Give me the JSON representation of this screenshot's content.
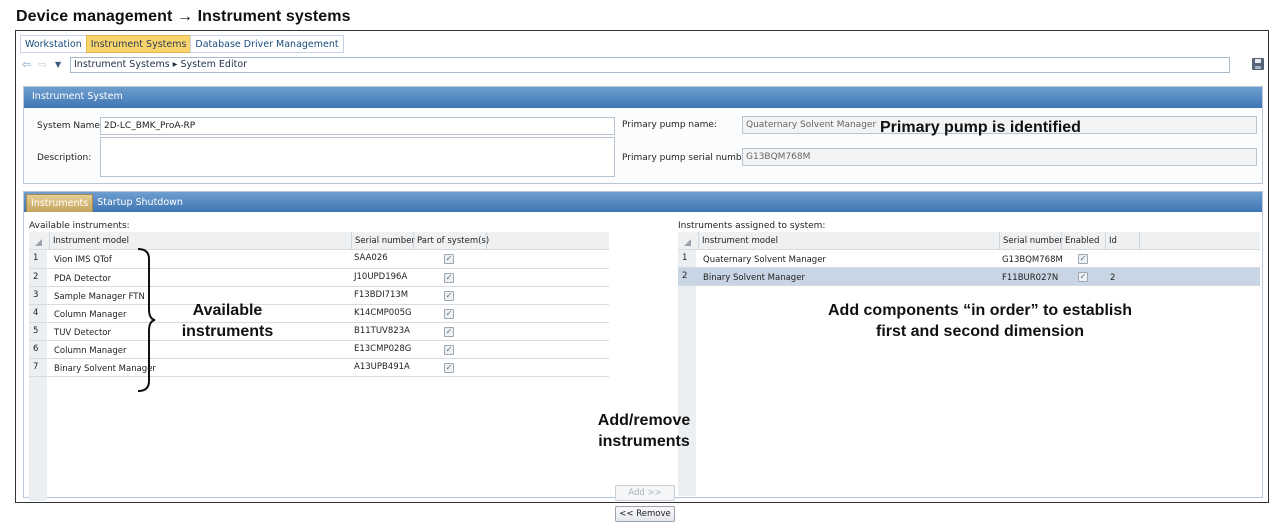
{
  "heading": "Device management → Instrument systems",
  "top_tabs": [
    {
      "label": "Workstation",
      "active": false
    },
    {
      "label": "Instrument Systems",
      "active": true
    },
    {
      "label": "Database Driver Management",
      "active": false
    }
  ],
  "nav": {
    "back_icon": "back-arrow-icon",
    "forward_icon": "forward-arrow-icon",
    "dropdown_icon": "chevron-down-icon",
    "breadcrumb": "Instrument Systems ▸ System Editor",
    "save_icon": "save-icon"
  },
  "instrument_system": {
    "header": "Instrument System",
    "system_name_label": "System Name:",
    "system_name_value": "2D-LC_BMK_ProA-RP",
    "description_label": "Description:",
    "description_value": "",
    "primary_pump_name_label": "Primary pump name:",
    "primary_pump_name_value": "Quaternary Solvent Manager",
    "primary_pump_serial_label": "Primary pump serial number:",
    "primary_pump_serial_value": "G13BQM768M"
  },
  "section_tabs": [
    {
      "label": "Instruments",
      "active": true
    },
    {
      "label": "Startup Shutdown",
      "active": false
    }
  ],
  "available": {
    "caption": "Available instruments:",
    "columns": [
      "Instrument model",
      "Serial number",
      "Part of system(s)"
    ],
    "rows": [
      {
        "n": "1",
        "model": "Vion IMS QTof",
        "serial": "SAA026",
        "part": true
      },
      {
        "n": "2",
        "model": "PDA Detector",
        "serial": "J10UPD196A",
        "part": true
      },
      {
        "n": "3",
        "model": "Sample Manager FTN",
        "serial": "F13BDI713M",
        "part": true
      },
      {
        "n": "4",
        "model": "Column Manager",
        "serial": "K14CMP005G",
        "part": true
      },
      {
        "n": "5",
        "model": "TUV Detector",
        "serial": "B11TUV823A",
        "part": true
      },
      {
        "n": "6",
        "model": "Column Manager",
        "serial": "E13CMP028G",
        "part": true
      },
      {
        "n": "7",
        "model": "Binary Solvent Manager",
        "serial": "A13UPB491A",
        "part": true
      }
    ]
  },
  "assigned": {
    "caption": "Instruments assigned to system:",
    "columns": [
      "Instrument model",
      "Serial number",
      "Enabled",
      "Id"
    ],
    "rows": [
      {
        "n": "1",
        "model": "Quaternary Solvent Manager",
        "serial": "G13BQM768M",
        "enabled": true,
        "id": ""
      },
      {
        "n": "2",
        "model": "Binary Solvent Manager",
        "serial": "F11BUR027N",
        "enabled": true,
        "id": "2"
      }
    ]
  },
  "buttons": {
    "add": "Add >>",
    "remove": "<< Remove"
  },
  "annotations": {
    "primary_pump": "Primary pump is identified",
    "available_line1": "Available",
    "available_line2": "instruments",
    "add_remove_line1": "Add/remove",
    "add_remove_line2": "instruments",
    "order_line1": "Add components “in order” to establish",
    "order_line2": "first and second dimension"
  },
  "check_glyph": "✓"
}
